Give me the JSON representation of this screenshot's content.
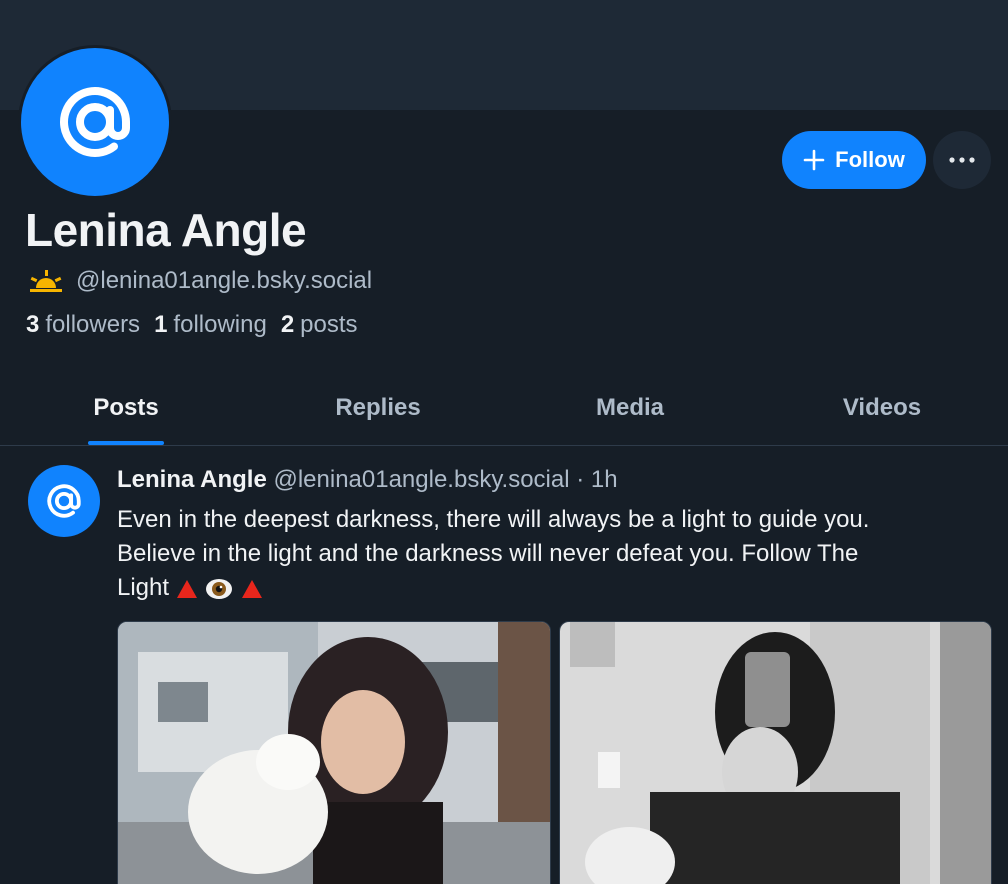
{
  "profile": {
    "display_name": "Lenina Angle",
    "handle": "@lenina01angle.bsky.social",
    "handle_emoji_icon": "sunrise-icon",
    "avatar_icon": "at-sign-icon",
    "stats": {
      "followers_count": "3",
      "followers_label": "followers",
      "following_count": "1",
      "following_label": "following",
      "posts_count": "2",
      "posts_label": "posts"
    }
  },
  "actions": {
    "follow_label": "Follow",
    "more_icon": "ellipsis-icon"
  },
  "tabs": [
    {
      "label": "Posts",
      "active": true
    },
    {
      "label": "Replies",
      "active": false
    },
    {
      "label": "Media",
      "active": false
    },
    {
      "label": "Videos",
      "active": false
    }
  ],
  "post": {
    "author_name": "Lenina Angle",
    "author_handle": "@lenina01angle.bsky.social",
    "separator": " · ",
    "time": "1h",
    "text_line1": "Even in the deepest darkness, there will always be a light to guide you.",
    "text_line2": "Believe in the light and the darkness will never defeat you. Follow The",
    "text_line3": "Light",
    "images": [
      {
        "description_icon": "photo-woman-with-dog"
      },
      {
        "description_icon": "photo-mirror-selfie"
      }
    ]
  },
  "colors": {
    "background": "#161e27",
    "banner": "#1e2936",
    "accent": "#1083fe",
    "text_primary": "#f1f3f5",
    "text_secondary": "#aebbc9"
  }
}
